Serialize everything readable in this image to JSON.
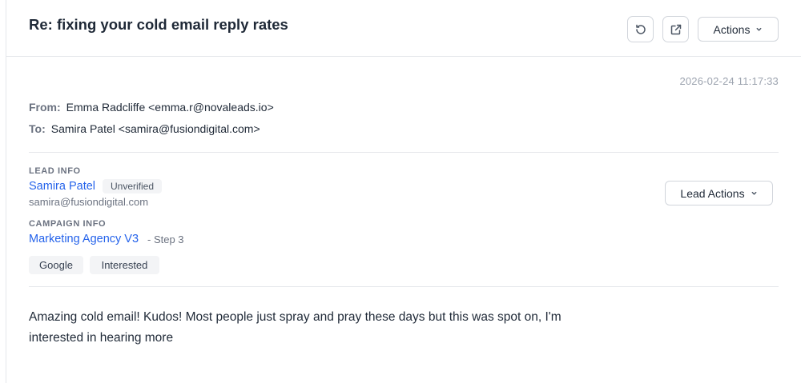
{
  "header": {
    "subject": "Re: fixing your cold email reply rates",
    "actions_label": "Actions",
    "refresh_icon": "refresh-icon",
    "external_icon": "external-link-icon"
  },
  "message": {
    "timestamp": "2026-02-24 11:17:33",
    "from_key": "From:",
    "from_value": "Emma Radcliffe <emma.r@novaleads.io>",
    "to_key": "To:",
    "to_value": "Samira Patel <samira@fusiondigital.com>",
    "body": "Amazing cold email! Kudos! Most people just spray and pray these days but this was spot on, I'm interested in hearing more"
  },
  "lead": {
    "section_label": "LEAD INFO",
    "name": "Samira Patel",
    "status": "Unverified",
    "email": "samira@fusiondigital.com",
    "actions_label": "Lead Actions"
  },
  "campaign": {
    "section_label": "CAMPAIGN INFO",
    "name": "Marketing Agency V3",
    "step": "- Step 3"
  },
  "tags": [
    "Google",
    "Interested"
  ],
  "colors": {
    "link": "#2563eb",
    "muted": "#6b7280",
    "border": "#e5e7eb",
    "badge_bg": "#f3f4f6"
  }
}
